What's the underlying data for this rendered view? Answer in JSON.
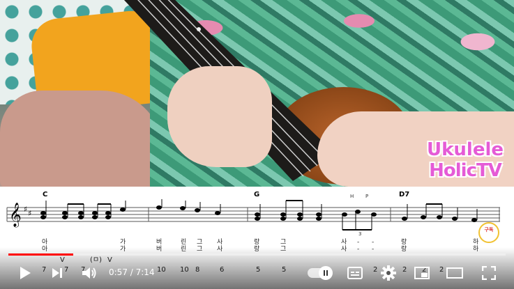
{
  "video": {
    "logo_line1": "Ukulele",
    "logo_line2": "HolicTV"
  },
  "sheet": {
    "chords": [
      "C",
      "G",
      "D7"
    ],
    "lyrics_row1": [
      "아",
      "가",
      "버",
      "린",
      "그",
      "사",
      "랑",
      "그",
      "사",
      "-",
      "-",
      "랑",
      "하"
    ],
    "lyrics_row2": [
      "아",
      "가",
      "버",
      "린",
      "그",
      "사",
      "랑",
      "그",
      "사",
      "-",
      "-",
      "랑",
      "하"
    ],
    "tab_numbers": [
      "7",
      "7",
      "7",
      "10",
      "10",
      "8",
      "6",
      "5",
      "5",
      "2",
      "2",
      "2",
      "2"
    ],
    "strum_marks": [
      "V",
      "(ㅁ)",
      "V",
      "V"
    ],
    "hp_labels": [
      "H",
      "P"
    ],
    "triplet": "3",
    "subscribe_badge": "구독"
  },
  "player": {
    "time_current": "0:57",
    "time_separator": " / ",
    "time_total": "7:14",
    "progress": 0.131,
    "colors": {
      "progress": "#ff0000",
      "logo": "#e55bd6"
    }
  },
  "icons": [
    "play-icon",
    "next-icon",
    "volume-icon",
    "autoplay-toggle",
    "subtitles-icon",
    "settings-icon",
    "miniplayer-icon",
    "theater-icon",
    "fullscreen-icon"
  ]
}
